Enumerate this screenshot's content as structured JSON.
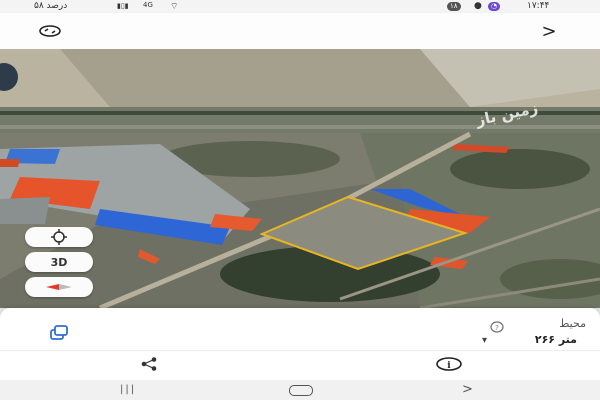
{
  "status_bar": {
    "time": "۱۷:۴۴",
    "notification_count": "۱۸",
    "battery": "۵۸ درصد",
    "signal": "4G"
  },
  "map_controls": {
    "mode_3d_label": "3D"
  },
  "watermark": "زمین باز",
  "sheet": {
    "title": "محیط",
    "value": "۲۶۶ متر"
  },
  "colors": {
    "boundary": "#e7b522",
    "accent": "#2f6fd6"
  }
}
